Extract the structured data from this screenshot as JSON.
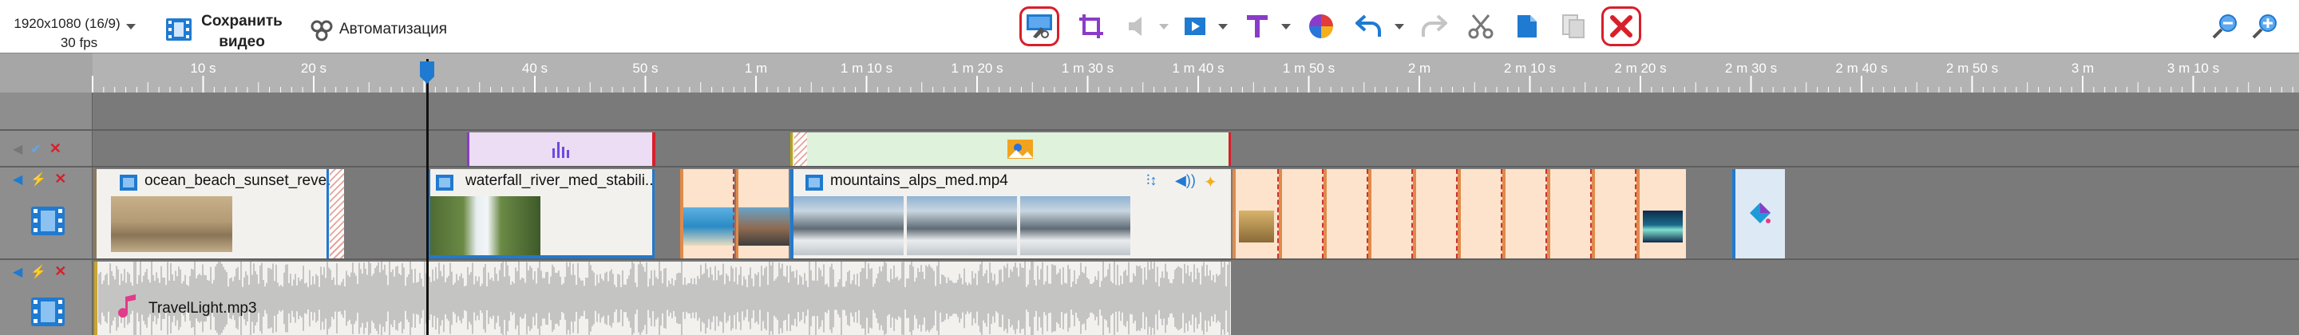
{
  "toolbar": {
    "resolution": "1920x1080 (16/9)",
    "fps": "30 fps",
    "save_label_1": "Сохранить",
    "save_label_2": "видео",
    "automation_label": "Автоматизация"
  },
  "ruler": {
    "labels": [
      "10 s",
      "20 s",
      "3",
      "40 s",
      "50 s",
      "1 m",
      "1 m 10 s",
      "1 m 20 s",
      "1 m 30 s",
      "1 m 40 s",
      "1 m 50 s",
      "2 m",
      "2 m 10 s",
      "2 m 20 s",
      "2 m 30 s",
      "2 m 40 s",
      "2 m 50 s",
      "3 m",
      "3 m 10 s"
    ]
  },
  "clips": {
    "video1": "ocean_beach_sunset_reve...",
    "video2": "waterfall_river_med_stabili...",
    "video3": "mountains_alps_med.mp4",
    "audio": "TravelLight.mp3"
  },
  "colors": {
    "accent_red": "#d81f2a",
    "blue": "#1f7ad1",
    "purple": "#8a3cc8",
    "orange": "#e08a4a",
    "audio_wave": "#b5b5b5"
  },
  "icons": [
    "chevron-down-icon",
    "film-save-icon",
    "cogs-icon",
    "auto-edit-icon",
    "crop-icon",
    "volume-icon",
    "play-insert-icon",
    "text-T-icon",
    "color-wheel-icon",
    "undo-icon",
    "redo-icon",
    "scissors-icon",
    "copy-icon",
    "paste-icon",
    "delete-icon",
    "zoom-out-icon",
    "zoom-in-icon"
  ]
}
